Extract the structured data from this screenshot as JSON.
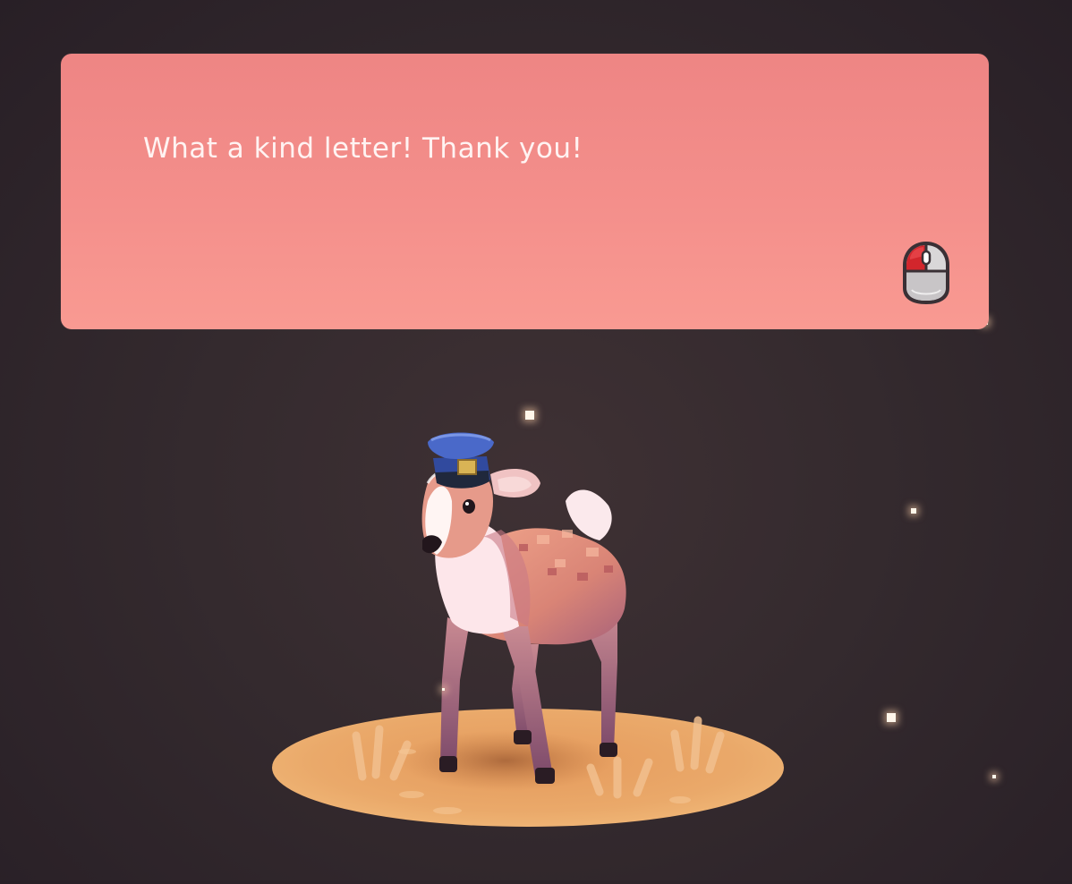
{
  "dialog": {
    "text": "What a kind letter! Thank you!",
    "advance_icon": "mouse-left-click-icon"
  },
  "scene": {
    "character": "deer-with-postal-cap",
    "platform": "round-sand-platform"
  },
  "colors": {
    "background": "#342a2e",
    "dialog_box": "#f48f8b",
    "dialog_text": "#fff3f2",
    "platform": "#e8a766",
    "cap": "#3a55a8",
    "deer_fur": "#d98a78"
  }
}
